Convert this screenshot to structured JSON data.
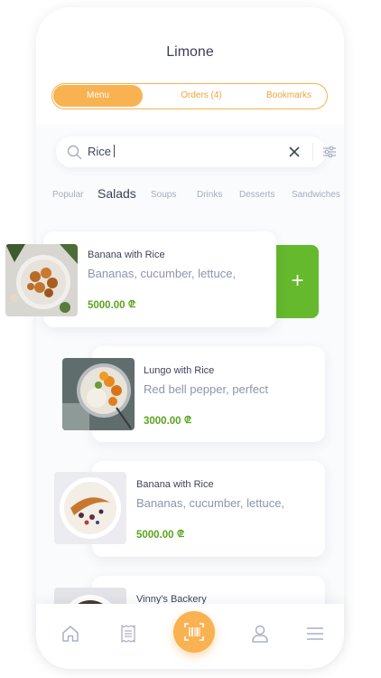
{
  "app": {
    "title": "Limone"
  },
  "segments": [
    {
      "label": "Menu",
      "active": true
    },
    {
      "label": "Orders (4)",
      "active": false
    },
    {
      "label": "Bookmarks",
      "active": false
    }
  ],
  "search": {
    "value": "Rice"
  },
  "categories": [
    {
      "label": "Popular",
      "active": false
    },
    {
      "label": "Salads",
      "active": true
    },
    {
      "label": "Soups",
      "active": false
    },
    {
      "label": "Drinks",
      "active": false
    },
    {
      "label": "Desserts",
      "active": false
    },
    {
      "label": "Sandwiches",
      "active": false
    }
  ],
  "items": [
    {
      "name": "Banana with Rice",
      "description": "Bananas, cucumber, lettuce,",
      "price": "5000.00",
      "currency_icon": "lari-icon"
    },
    {
      "name": "Lungo with Rice",
      "description": "Red bell pepper, perfect",
      "price": "3000.00",
      "currency_icon": "lari-icon"
    },
    {
      "name": "Banana with Rice",
      "description": "Bananas, cucumber, lettuce,",
      "price": "5000.00",
      "currency_icon": "lari-icon"
    },
    {
      "name": "Vinny's Backery",
      "description": "",
      "price": "",
      "currency_icon": "lari-icon"
    }
  ],
  "add_button": {
    "label": "+"
  },
  "nav": [
    "home-icon",
    "receipt-icon",
    "scan-icon",
    "profile-icon",
    "menu-icon"
  ],
  "colors": {
    "accent": "#f9b251",
    "price": "#5aa51f",
    "add": "#65b92c",
    "text": "#3a4058"
  }
}
